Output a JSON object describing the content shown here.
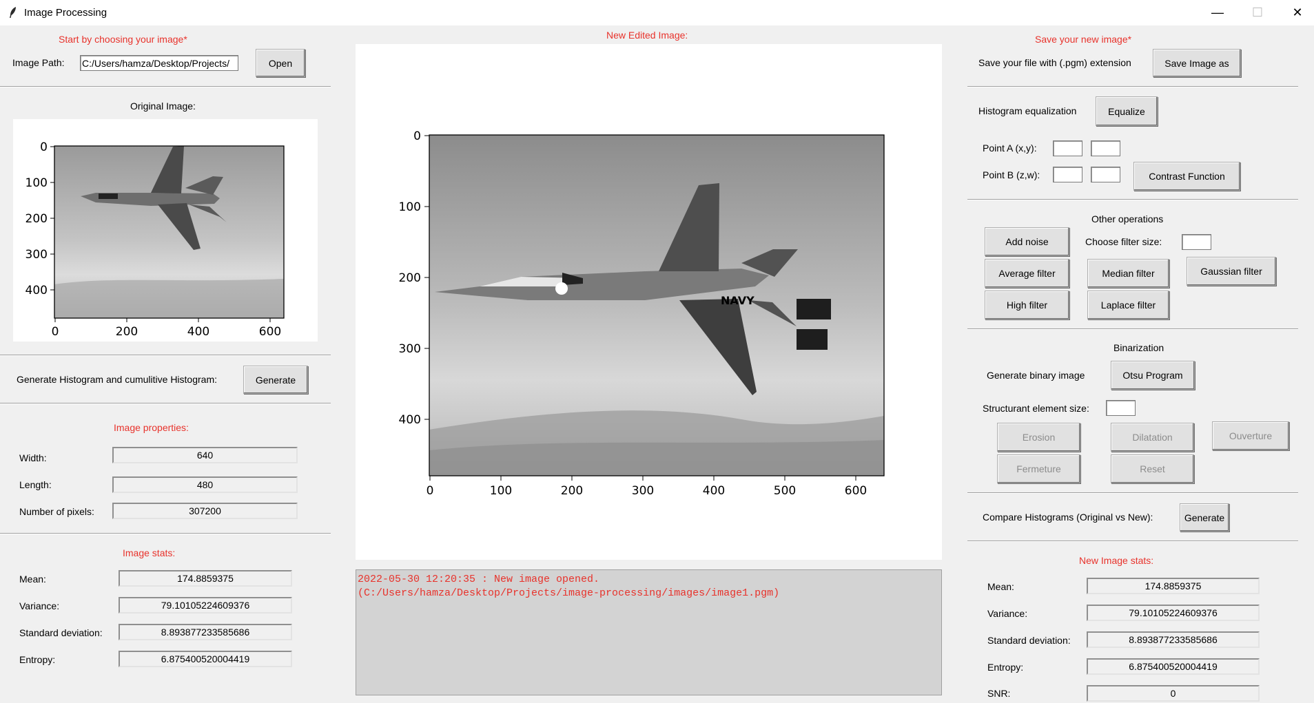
{
  "window": {
    "title": "Image Processing",
    "controls": [
      "—",
      "☐",
      "✕"
    ]
  },
  "left": {
    "start_label": "Start by choosing your image*",
    "path_label": "Image Path:",
    "path_value": "C:/Users/hamza/Desktop/Projects/",
    "open_button": "Open",
    "original_title": "Original Image:",
    "histogram_label": "Generate Histogram and cumulitive Histogram:",
    "histogram_button": "Generate",
    "props_title": "Image properties:",
    "props": [
      {
        "label": "Width:",
        "value": "640"
      },
      {
        "label": "Length:",
        "value": "480"
      },
      {
        "label": "Number of pixels:",
        "value": "307200"
      }
    ],
    "stats_title": "Image stats:",
    "stats": [
      {
        "label": "Mean:",
        "value": "174.8859375"
      },
      {
        "label": "Variance:",
        "value": "79.10105224609376"
      },
      {
        "label": "Standard deviation:",
        "value": "8.893877233585686"
      },
      {
        "label": "Entropy:",
        "value": "6.875400520004419"
      }
    ]
  },
  "center": {
    "title": "New Edited Image:",
    "log_line1": "2022-05-30 12:20:35 : New image opened.",
    "log_line2": "(C:/Users/hamza/Desktop/Projects/image-processing/images/image1.pgm)"
  },
  "original_plot": {
    "x_ticks": [
      "0",
      "200",
      "400",
      "600"
    ],
    "y_ticks": [
      "0",
      "100",
      "200",
      "300",
      "400"
    ]
  },
  "edited_plot": {
    "x_ticks": [
      "0",
      "100",
      "200",
      "300",
      "400",
      "500",
      "600"
    ],
    "y_ticks": [
      "0",
      "100",
      "200",
      "300",
      "400"
    ]
  },
  "right": {
    "save_title": "Save your new image*",
    "save_label": "Save your file with (.pgm) extension",
    "save_button": "Save Image as",
    "hist_eq_label": "Histogram equalization",
    "equalize_button": "Equalize",
    "point_a_label": "Point A (x,y):",
    "point_b_label": "Point B (z,w):",
    "contrast_button": "Contrast Function",
    "other_title": "Other operations",
    "add_noise_button": "Add noise",
    "filter_size_label": "Choose filter size:",
    "average_button": "Average filter",
    "median_button": "Median filter",
    "gaussian_button": "Gaussian filter",
    "high_button": "High filter",
    "laplace_button": "Laplace filter",
    "binarization_title": "Binarization",
    "binary_label": "Generate binary image",
    "otsu_button": "Otsu Program",
    "struct_label": "Structurant element size:",
    "erosion_button": "Erosion",
    "dilatation_button": "Dilatation",
    "ouverture_button": "Ouverture",
    "fermeture_button": "Fermeture",
    "reset_button": "Reset",
    "compare_label": "Compare Histograms (Original vs New):",
    "compare_button": "Generate",
    "new_stats_title": "New Image stats:",
    "new_stats": [
      {
        "label": "Mean:",
        "value": "174.8859375"
      },
      {
        "label": "Variance:",
        "value": "79.10105224609376"
      },
      {
        "label": "Standard deviation:",
        "value": "8.893877233585686"
      },
      {
        "label": "Entropy:",
        "value": "6.875400520004419"
      },
      {
        "label": "SNR:",
        "value": "0"
      }
    ]
  }
}
